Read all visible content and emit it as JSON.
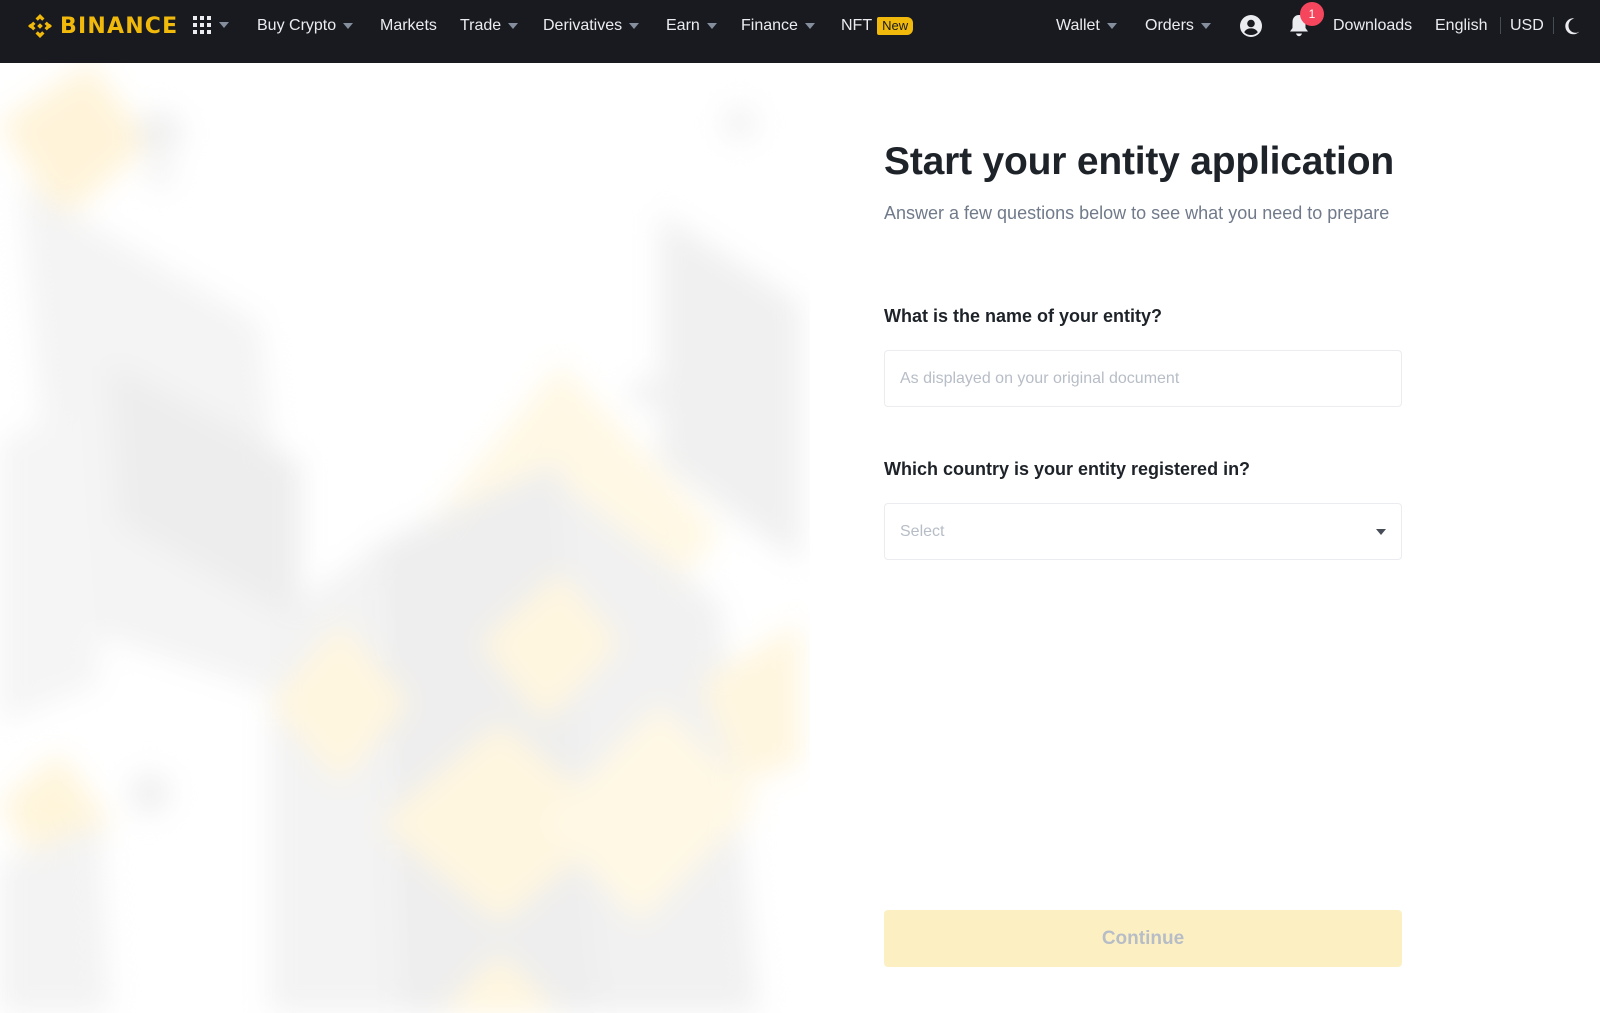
{
  "brand": {
    "name": "BINANCE",
    "accent": "#f0b90b",
    "nav_bg": "#181a20"
  },
  "nav": {
    "items": [
      {
        "label": "Buy Crypto",
        "dropdown": true
      },
      {
        "label": "Markets",
        "dropdown": false
      },
      {
        "label": "Trade",
        "dropdown": true
      },
      {
        "label": "Derivatives",
        "dropdown": true
      },
      {
        "label": "Earn",
        "dropdown": true
      },
      {
        "label": "Finance",
        "dropdown": true
      },
      {
        "label": "NFT",
        "badge": "New"
      }
    ],
    "right": {
      "wallet": "Wallet",
      "orders": "Orders",
      "notifications_count": "1",
      "downloads": "Downloads",
      "language": "English",
      "currency": "USD"
    },
    "icons": [
      "apps-grid-icon",
      "user-icon",
      "bell-icon",
      "moon-icon"
    ]
  },
  "form": {
    "title": "Start your entity application",
    "subtitle": "Answer a few questions below to see what you need to prepare",
    "entity_name": {
      "label": "What is the name of your entity?",
      "placeholder": "As displayed on your original document",
      "value": ""
    },
    "country": {
      "label": "Which country is your entity registered in?",
      "placeholder": "Select"
    },
    "continue_label": "Continue"
  }
}
